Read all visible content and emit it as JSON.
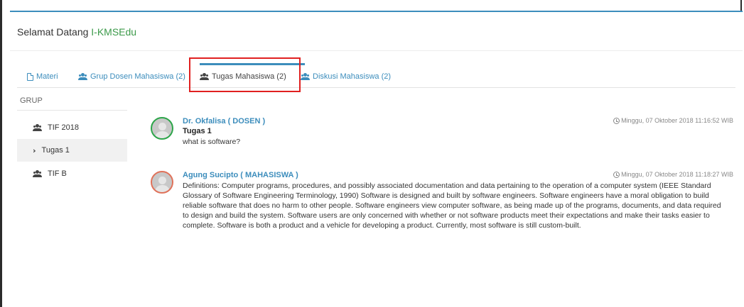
{
  "header": {
    "greeting": "Selamat Datang ",
    "app_name": "I-KMSEdu"
  },
  "tabs": [
    {
      "label": "Materi"
    },
    {
      "label": "Grup Dosen Mahasiswa (2)"
    },
    {
      "label": "Tugas Mahasiswa (2)"
    },
    {
      "label": "Diskusi Mahasiswa (2)"
    }
  ],
  "sidebar": {
    "label": "GRUP",
    "items": [
      {
        "label": "TIF 2018"
      },
      {
        "label": "Tugas 1"
      },
      {
        "label": "TIF B"
      }
    ]
  },
  "posts": [
    {
      "author": "Dr. Okfalisa ( DOSEN )",
      "date": "Minggu, 07 Oktober 2018 11:16:52 WIB",
      "title": "Tugas 1",
      "text": "what is software?"
    },
    {
      "author": "Agung Sucipto ( MAHASISWA )",
      "date": "Minggu, 07 Oktober 2018 11:18:27 WIB",
      "text": "Definitions: Computer programs, procedures, and possibly associated documentation and data pertaining to the operation of a computer system (IEEE Standard Glossary of Software Engineering Terminology, 1990) Software is designed and built by software engineers. Software engineers have a moral obligation to build reliable software that does no harm to other people. Software engineers view computer software, as being made up of the programs, documents, and data required to design and build the system. Software users are only concerned with whether or not software products meet their expectations and make their tasks easier to complete. Software is both a product and a vehicle for developing a product. Currently, most software is still custom-built."
    }
  ],
  "colors": {
    "accent": "#3c8dbc",
    "brand": "#3c9a4a",
    "highlight": "#e02020"
  }
}
